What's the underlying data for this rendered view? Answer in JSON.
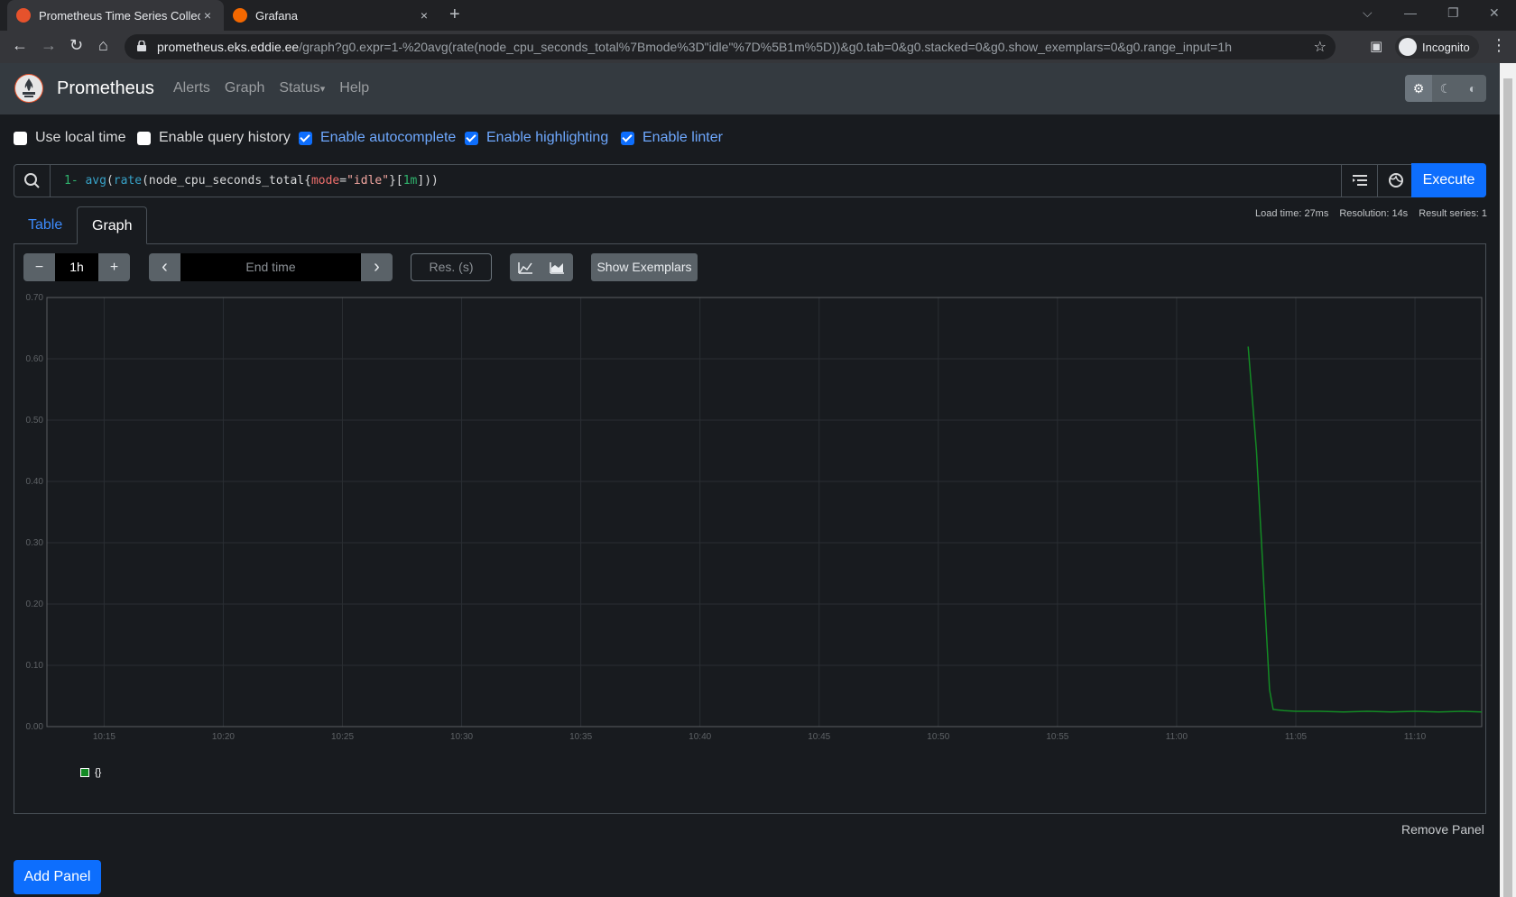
{
  "browser": {
    "tabs": [
      {
        "title": "Prometheus Time Series Collectio",
        "close": "×"
      },
      {
        "title": "Grafana",
        "close": "×"
      }
    ],
    "new_tab": "+",
    "url_host": "prometheus.eks.eddie.ee",
    "url_path": "/graph?g0.expr=1-%20avg(rate(node_cpu_seconds_total%7Bmode%3D\"idle\"%7D%5B1m%5D))&g0.tab=0&g0.stacked=0&g0.show_exemplars=0&g0.range_input=1h",
    "profile": "Incognito"
  },
  "nav": {
    "brand": "Prometheus",
    "links": [
      "Alerts",
      "Graph",
      "Status",
      "Help"
    ],
    "status_caret": "▾"
  },
  "options": [
    {
      "label": "Use local time",
      "checked": false
    },
    {
      "label": "Enable query history",
      "checked": false
    },
    {
      "label": "Enable autocomplete",
      "checked": true
    },
    {
      "label": "Enable highlighting",
      "checked": true
    },
    {
      "label": "Enable linter",
      "checked": true
    }
  ],
  "query": {
    "expr_parts": [
      {
        "t": "1- ",
        "c": "#2fb36d"
      },
      {
        "t": "avg",
        "c": "#37a2c8"
      },
      {
        "t": "(",
        "c": "#d8d9da"
      },
      {
        "t": "rate",
        "c": "#37a2c8"
      },
      {
        "t": "(node_cpu_seconds_total{",
        "c": "#d8d9da"
      },
      {
        "t": "mode",
        "c": "#ef6f6c"
      },
      {
        "t": "=",
        "c": "#d8d9da"
      },
      {
        "t": "\"idle\"",
        "c": "#f2a6a0"
      },
      {
        "t": "}[",
        "c": "#d8d9da"
      },
      {
        "t": "1m",
        "c": "#2fb36d"
      },
      {
        "t": "]))",
        "c": "#d8d9da"
      }
    ],
    "execute_label": "Execute"
  },
  "stats": {
    "load_time": "Load time: 27ms",
    "resolution": "Resolution: 14s",
    "result_series": "Result series: 1"
  },
  "panel_tabs": {
    "table": "Table",
    "graph": "Graph"
  },
  "graph_controls": {
    "minus": "−",
    "range": "1h",
    "plus": "+",
    "prev": "‹",
    "end_time_placeholder": "End time",
    "next": "›",
    "res_placeholder": "Res. (s)",
    "show_exemplars": "Show Exemplars"
  },
  "chart_data": {
    "type": "line",
    "title": "",
    "xlabel": "",
    "ylabel": "",
    "ylim": [
      0,
      0.7
    ],
    "y_ticks": [
      "0.00",
      "0.10",
      "0.20",
      "0.30",
      "0.40",
      "0.50",
      "0.60",
      "0.70"
    ],
    "x_ticks": [
      "10:15",
      "10:20",
      "10:25",
      "10:30",
      "10:35",
      "10:40",
      "10:45",
      "10:50",
      "10:55",
      "11:00",
      "11:05",
      "11:10"
    ],
    "x_range_minutes": [
      12.6,
      72.8
    ],
    "grid": true,
    "series": [
      {
        "name": "{}",
        "color": "#138a24",
        "points": [
          [
            63.0,
            0.62
          ],
          [
            63.35,
            0.45
          ],
          [
            63.7,
            0.2
          ],
          [
            63.9,
            0.06
          ],
          [
            64.05,
            0.028
          ],
          [
            64.5,
            0.026
          ],
          [
            65.0,
            0.025
          ],
          [
            66.0,
            0.025
          ],
          [
            67.0,
            0.024
          ],
          [
            68.0,
            0.025
          ],
          [
            69.0,
            0.024
          ],
          [
            70.0,
            0.025
          ],
          [
            71.0,
            0.024
          ],
          [
            72.0,
            0.025
          ],
          [
            72.8,
            0.024
          ]
        ]
      }
    ]
  },
  "legend": {
    "label": "{}",
    "color": "#138a24"
  },
  "footer": {
    "remove_panel": "Remove Panel",
    "add_panel": "Add Panel"
  }
}
